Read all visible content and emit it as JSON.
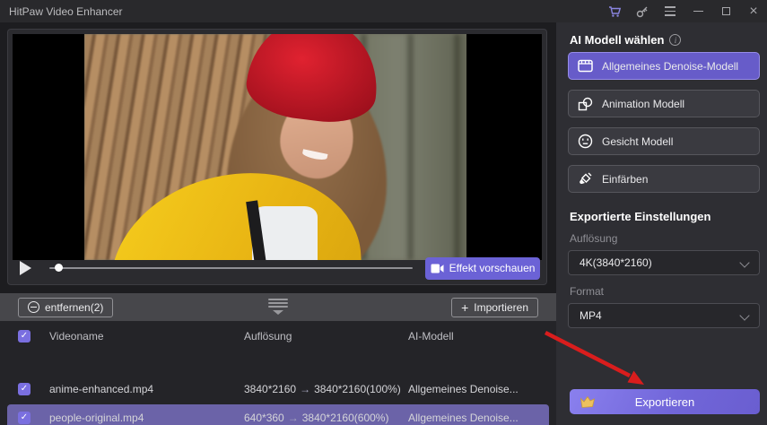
{
  "titlebar": {
    "title": "HitPaw Video Enhancer"
  },
  "player": {
    "preview_button_label": "Effekt vorschauen"
  },
  "file_list": {
    "remove_label": "entfernen(2)",
    "import_plus": "+",
    "import_label": "Importieren",
    "columns": {
      "name": "Videoname",
      "resolution": "Auflösung",
      "model": "AI-Modell"
    },
    "check_glyph": "✓",
    "res_arrow_glyph": "→",
    "rows": [
      {
        "name": "anime-enhanced.mp4",
        "res_from": "3840*2160",
        "res_to": "3840*2160(100%)",
        "model": "Allgemeines Denoise..."
      },
      {
        "name": "people-original.mp4",
        "res_from": "640*360",
        "res_to": "3840*2160(600%)",
        "model": "Allgemeines Denoise..."
      }
    ]
  },
  "sidebar": {
    "heading": "AI Modell wählen",
    "info_glyph": "i",
    "models": [
      {
        "label": "Allgemeines Denoise-Modell"
      },
      {
        "label": "Animation Modell"
      },
      {
        "label": "Gesicht Modell"
      },
      {
        "label": "Einfärben"
      }
    ],
    "export_heading": "Exportierte Einstellungen",
    "resolution_label": "Auflösung",
    "resolution_value": "4K(3840*2160)",
    "format_label": "Format",
    "format_value": "MP4",
    "export_button_label": "Exportieren"
  },
  "window_controls": {
    "minimize": "",
    "maximize": "",
    "close": "×"
  },
  "colors": {
    "accent_purple": "#6b62d6",
    "selected_row_purple": "#6b63a8",
    "checkbox_purple": "#7a6fe0",
    "annotation_arrow_red": "#d91d1d",
    "crown_gold": "#edc15e"
  }
}
